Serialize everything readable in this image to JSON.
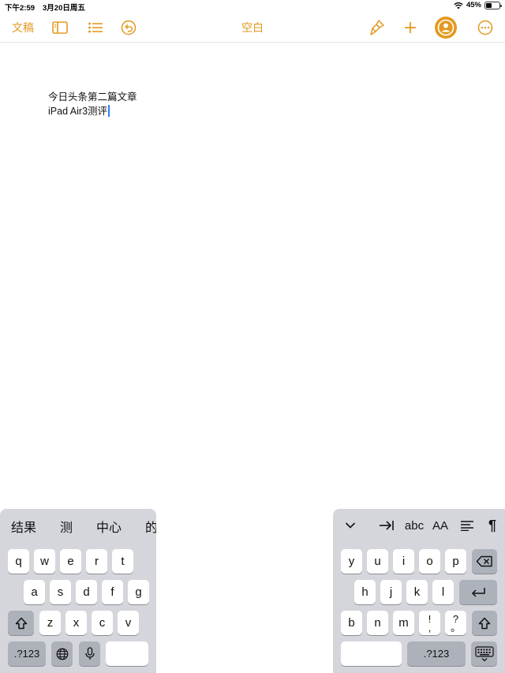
{
  "status_bar": {
    "time": "下午2:59",
    "date": "3月20日周五",
    "battery_text": "45%",
    "battery_level": 0.45
  },
  "toolbar": {
    "documents_label": "文稿",
    "title": "空白",
    "icons": [
      "sidebar-icon",
      "list-icon",
      "undo-icon",
      "paintbrush-icon",
      "plus-icon",
      "collaborate-icon",
      "more-icon"
    ],
    "accent_color": "#e39a20"
  },
  "document": {
    "lines": [
      "今日头条第二篇文章",
      "iPad Air3测评"
    ]
  },
  "keyboard": {
    "candidates": [
      "结果",
      "测",
      "中心",
      "的"
    ],
    "right_toolbar": {
      "tab_symbol": "→|",
      "abc": "abc",
      "font_size": "AA",
      "paragraph": "¶"
    },
    "left_rows": [
      [
        "q",
        "w",
        "e",
        "r",
        "t"
      ],
      [
        "a",
        "s",
        "d",
        "f",
        "g"
      ],
      [
        "z",
        "x",
        "c",
        "v"
      ]
    ],
    "right_rows": [
      [
        "y",
        "u",
        "i",
        "o",
        "p"
      ],
      [
        "h",
        "j",
        "k",
        "l"
      ],
      [
        "b",
        "n",
        "m"
      ]
    ],
    "punct_keys": [
      {
        "top": "!",
        "bottom": ","
      },
      {
        "top": "?",
        "bottom": "。"
      }
    ],
    "numbers_label": ".?123",
    "numbers_label_right": ".?123"
  }
}
